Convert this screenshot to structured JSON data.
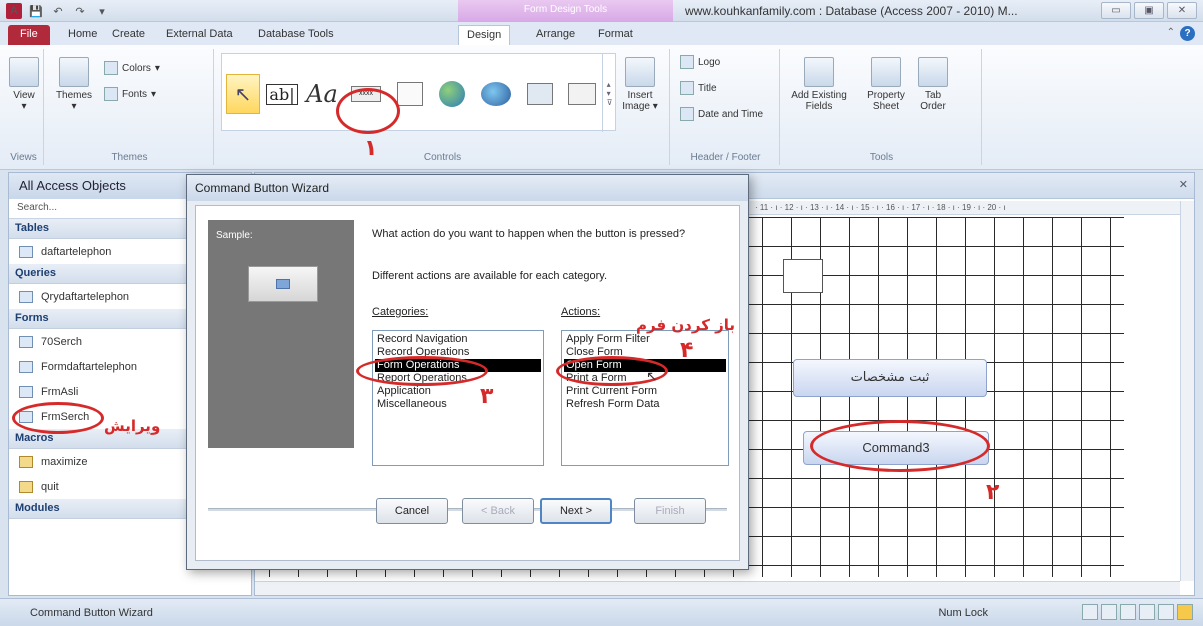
{
  "titlebar": {
    "app_logo": "A",
    "quick_access": [
      "save-icon",
      "undo-icon",
      "redo-icon",
      "customize-icon"
    ],
    "contextual_group": "Form Design Tools",
    "window_title": "www.kouhkanfamily.com : Database (Access 2007 - 2010) M...",
    "controls": [
      "minimize-icon",
      "maximize-icon",
      "close-icon"
    ]
  },
  "tabs": [
    "File",
    "Home",
    "Create",
    "External Data",
    "Database Tools",
    "Design",
    "Arrange",
    "Format"
  ],
  "active_tab": "Design",
  "ribbon": {
    "views_group": {
      "label": "Views",
      "view_button": "View"
    },
    "themes_group": {
      "label": "Themes",
      "themes_button": "Themes",
      "colors": "Colors",
      "fonts": "Fonts"
    },
    "controls_group": {
      "label": "Controls",
      "insert_image": "Insert Image"
    },
    "header_footer_group": {
      "label": "Header / Footer",
      "logo": "Logo",
      "title": "Title",
      "date_time": "Date and Time"
    },
    "tools_group": {
      "label": "Tools",
      "add_existing": "Add Existing Fields",
      "property_sheet": "Property Sheet",
      "tab_order": "Tab Order"
    }
  },
  "nav_pane": {
    "title": "All Access Objects",
    "search_placeholder": "Search...",
    "sections": [
      {
        "name": "Tables",
        "items": [
          "daftartelephon"
        ]
      },
      {
        "name": "Queries",
        "items": [
          "Qrydaftartelephon"
        ]
      },
      {
        "name": "Forms",
        "items": [
          "70Serch",
          "Formdaftartelephon",
          "FrmAsli",
          "FrmSerch"
        ]
      },
      {
        "name": "Macros",
        "items": [
          "maximize",
          "quit"
        ]
      },
      {
        "name": "Modules",
        "items": []
      }
    ]
  },
  "form_design": {
    "button_submit_label": "ثبت مشخصات",
    "button_command_label": "Command3",
    "ruler_text": "· 11 · ı · 12 · ı · 13 · ı · 14 · ı · 15 · ı · 16 · ı · 17 · ı · 18 · ı · 19 · ı · 20 · ı"
  },
  "dialog": {
    "title": "Command Button Wizard",
    "sample_label": "Sample:",
    "question": "What action do you want to happen when the button is pressed?",
    "different_actions": "Different actions are available for each category.",
    "categories_label": "Categories:",
    "actions_label": "Actions:",
    "categories": [
      "Record Navigation",
      "Record Operations",
      "Form Operations",
      "Report Operations",
      "Application",
      "Miscellaneous"
    ],
    "selected_category": "Form Operations",
    "actions": [
      "Apply Form Filter",
      "Close Form",
      "Open Form",
      "Print a Form",
      "Print Current Form",
      "Refresh Form Data"
    ],
    "selected_action": "Open Form",
    "buttons": {
      "cancel": "Cancel",
      "back": "< Back",
      "next": "Next >",
      "finish": "Finish"
    }
  },
  "annotations": {
    "n1": "۱",
    "n2": "۲",
    "n3": "۳",
    "n4": "۴",
    "edit_label": "ویرایش",
    "open_form_label": "باز کردن فرم"
  },
  "status": {
    "text": "Command Button Wizard",
    "num_lock": "Num Lock"
  },
  "colors": {
    "annotation_red": "#d62a2a",
    "file_tab": "#b12a3c",
    "contextual_tab": "#d8a8e6"
  }
}
